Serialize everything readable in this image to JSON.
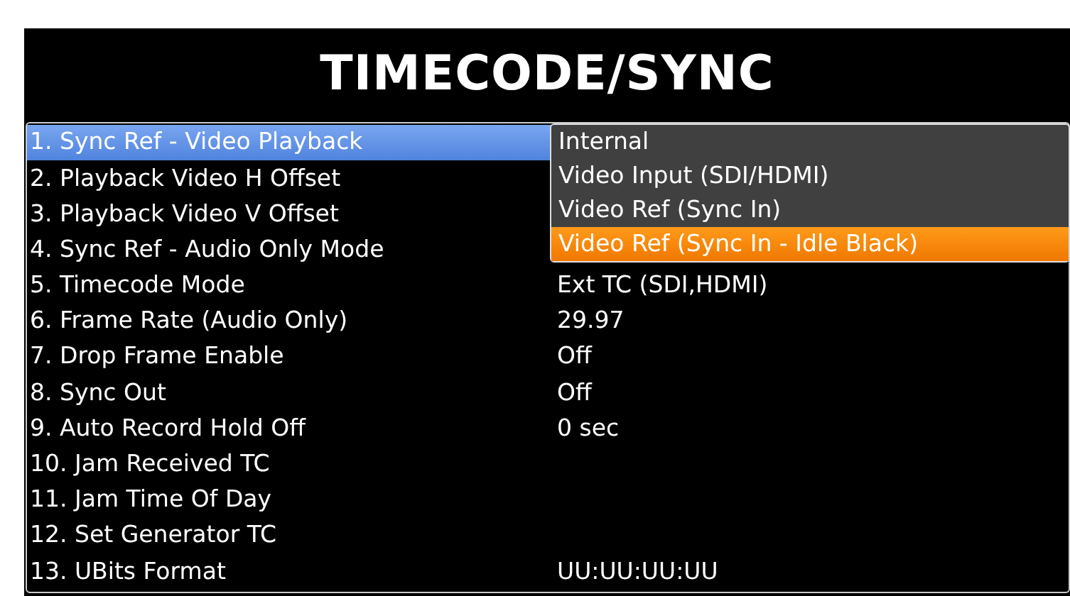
{
  "title": "TIMECODE/SYNC",
  "settings": [
    {
      "label": "1. Sync Ref - Video Playback",
      "selected": true
    },
    {
      "label": "2. Playback Video H Offset",
      "selected": false
    },
    {
      "label": "3. Playback Video V Offset",
      "selected": false
    },
    {
      "label": "4. Sync Ref - Audio Only Mode",
      "selected": false
    },
    {
      "label": "5. Timecode Mode",
      "value": "Ext TC (SDI,HDMI)",
      "selected": false
    },
    {
      "label": "6. Frame Rate (Audio Only)",
      "value": "29.97",
      "selected": false
    },
    {
      "label": "7. Drop Frame Enable",
      "value": "Off",
      "selected": false
    },
    {
      "label": "8. Sync Out",
      "value": "Off",
      "selected": false
    },
    {
      "label": "9. Auto Record Hold Off",
      "value": "0 sec",
      "selected": false
    },
    {
      "label": "10. Jam Received TC",
      "selected": false
    },
    {
      "label": "11. Jam Time Of Day",
      "selected": false
    },
    {
      "label": "12. Set Generator TC",
      "selected": false
    },
    {
      "label": "13. UBits Format",
      "value": "UU:UU:UU:UU",
      "selected": false
    }
  ],
  "dropdown": {
    "options": [
      {
        "label": "Internal",
        "selected": false
      },
      {
        "label": "Video Input (SDI/HDMI)",
        "selected": false
      },
      {
        "label": "Video Ref (Sync In)",
        "selected": false
      },
      {
        "label": "Video Ref (Sync In - Idle Black)",
        "selected": true
      }
    ]
  }
}
